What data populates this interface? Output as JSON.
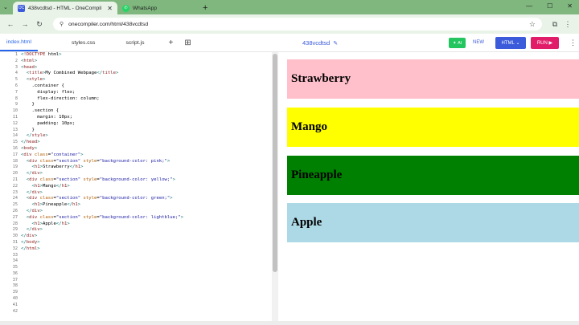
{
  "browser": {
    "tabs": [
      {
        "title": "438vcdtsd - HTML - OneCompil",
        "favicon": "oc",
        "favicon_color": "#3b5bdb",
        "active": true
      },
      {
        "title": "WhatsApp",
        "favicon": "wa",
        "favicon_color": "#25d366",
        "active": false
      }
    ],
    "url": "onecompiler.com/html/438vcdtsd"
  },
  "toolbar": {
    "files": [
      "index.html",
      "styles.css",
      "script.js"
    ],
    "project_name": "438vcdtsd",
    "ai_label": "AI",
    "new_label": "NEW",
    "lang_label": "HTML",
    "run_label": "RUN"
  },
  "editor": {
    "line_numbers": [
      "1",
      "2",
      "3",
      "4",
      "5",
      "6",
      "7",
      "8",
      "9",
      "10",
      "11",
      "12",
      "13",
      "14",
      "15",
      "16",
      "17",
      "18",
      "19",
      "20",
      "21",
      "22",
      "23",
      "24",
      "25",
      "26",
      "27",
      "28",
      "29",
      "30",
      "31",
      "32",
      "33",
      "34",
      "35",
      "36",
      "37",
      "38",
      "39",
      "40",
      "41",
      "42"
    ],
    "lines": [
      "<!DOCTYPE html>",
      "<html>",
      "<head>",
      "  <title>My Combined Webpage</title>",
      "  <style>",
      "    .container {",
      "      display: flex;",
      "      flex-direction: column;",
      "    }",
      "    .section {",
      "      margin: 10px;",
      "      padding: 10px;",
      "    }",
      "  </style>",
      "</head>",
      "<body>",
      "<div class=\"container\">",
      "  <div class=\"section\" style=\"background-color: pink;\">",
      "    <h1>Strawberry</h1>",
      "  </div>",
      "  <div class=\"section\" style=\"background-color: yellow;\">",
      "    <h1>Mango</h1>",
      "  </div>",
      "  <div class=\"section\" style=\"background-color: green;\">",
      "    <h1>Pineapple</h1>",
      "  </div>",
      "  <div class=\"section\" style=\"background-color: lightblue;\">",
      "    <h1>Apple</h1>",
      "  </div>",
      "</div>",
      "</body>",
      "</html>",
      "",
      "",
      "",
      "",
      "",
      "",
      "",
      "",
      "",
      ""
    ]
  },
  "output": {
    "sections": [
      {
        "label": "Strawberry",
        "color": "#ffc0cb"
      },
      {
        "label": "Mango",
        "color": "#ffff00"
      },
      {
        "label": "Pineapple",
        "color": "#008000"
      },
      {
        "label": "Apple",
        "color": "#add8e6"
      }
    ]
  }
}
